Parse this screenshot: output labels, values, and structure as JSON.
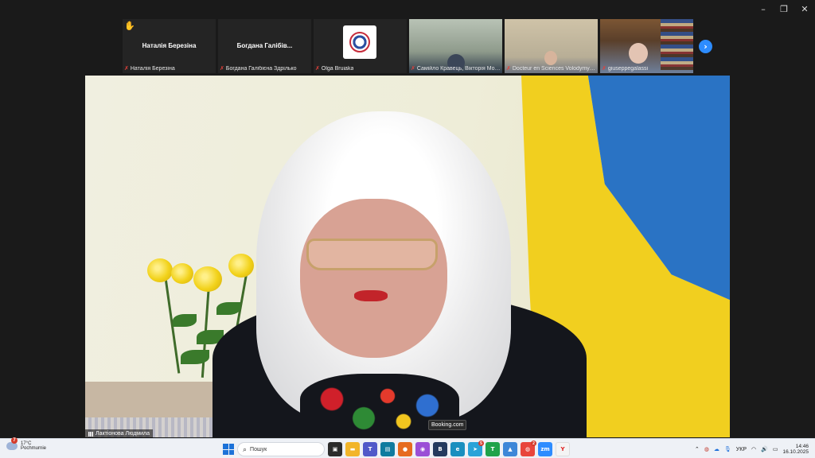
{
  "window": {
    "controls": [
      {
        "name": "minimize",
        "glyph": "–"
      },
      {
        "name": "maximize",
        "glyph": "❐"
      },
      {
        "name": "close",
        "glyph": "✕"
      }
    ]
  },
  "participants": [
    {
      "tile_name": "Наталія Березіна",
      "caption": "Наталія Березіна",
      "hand_raised": true,
      "muted": true,
      "type": "name"
    },
    {
      "tile_name": "Богдана Галібів...",
      "caption": "Богдана Галібієна Здрілько",
      "muted": true,
      "type": "name"
    },
    {
      "tile_name": "",
      "caption": "Olga Bruiaka",
      "muted": true,
      "type": "logo"
    },
    {
      "tile_name": "",
      "caption": "Самійло Кравець, Вікторія Мор...",
      "muted": true,
      "type": "video"
    },
    {
      "tile_name": "",
      "caption": "Docteur en Sciences Volodymyr ...",
      "muted": true,
      "type": "video"
    },
    {
      "tile_name": "",
      "caption": "giuseppegalassi",
      "muted": true,
      "type": "video"
    }
  ],
  "next_page_glyph": "›",
  "speaker": {
    "name": "Лактіонова Людмила"
  },
  "tooltip": "Booking.com",
  "taskbar": {
    "weather_badge": "7",
    "temperature": "17°C",
    "weather_condition": "Pochmurnie",
    "search_placeholder": "Пошук",
    "apps": [
      {
        "name": "task-view",
        "color": "#2b2b2b",
        "glyph": "▣"
      },
      {
        "name": "file-explorer",
        "color": "#f2b52a",
        "glyph": "▬"
      },
      {
        "name": "teams",
        "color": "#5059c9",
        "glyph": "T"
      },
      {
        "name": "media",
        "color": "#0f7b9f",
        "glyph": "▤"
      },
      {
        "name": "firefox",
        "color": "#e66b1f",
        "glyph": "●"
      },
      {
        "name": "copilot",
        "color": "#9b4fd6",
        "glyph": "◉"
      },
      {
        "name": "store",
        "color": "#243a5e",
        "glyph": "B"
      },
      {
        "name": "edge",
        "color": "#1a8fbf",
        "glyph": "e"
      },
      {
        "name": "telegram",
        "color": "#2aa3d8",
        "glyph": "➤",
        "badge": "5"
      },
      {
        "name": "notes",
        "color": "#1fa34a",
        "glyph": "T"
      },
      {
        "name": "image-viewer",
        "color": "#3d87d8",
        "glyph": "▲"
      },
      {
        "name": "chrome",
        "color": "#e8453c",
        "glyph": "◍",
        "badge": "2"
      },
      {
        "name": "zoom",
        "color": "#2d8cff",
        "glyph": "zm"
      },
      {
        "name": "yandex",
        "color": "#f4f4f4",
        "glyph": "Y"
      }
    ],
    "language": "УКР",
    "time": "14:46",
    "date": "16.10.2025"
  }
}
